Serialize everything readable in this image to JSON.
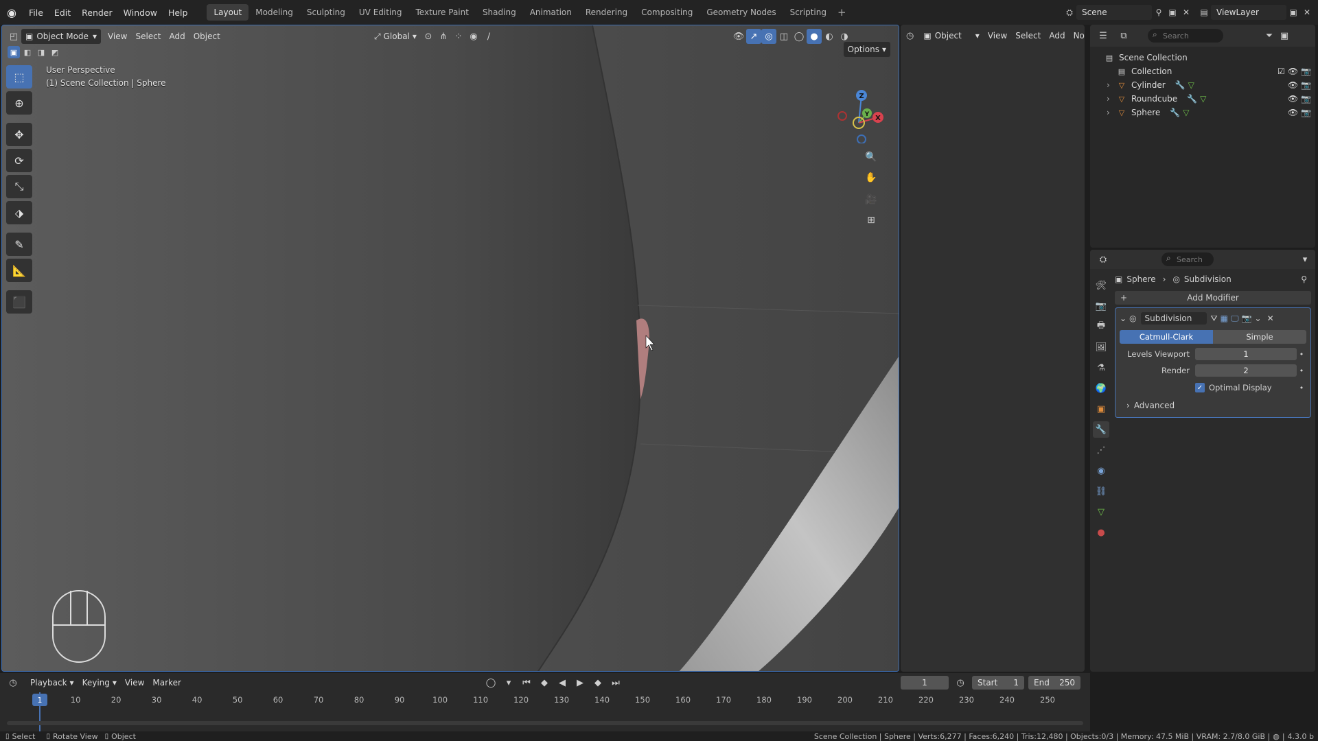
{
  "menubar": {
    "items": [
      "File",
      "Edit",
      "Render",
      "Window",
      "Help"
    ],
    "workspaces": [
      "Layout",
      "Modeling",
      "Sculpting",
      "UV Editing",
      "Texture Paint",
      "Shading",
      "Animation",
      "Rendering",
      "Compositing",
      "Geometry Nodes",
      "Scripting"
    ],
    "active_workspace": "Layout",
    "scene": "Scene",
    "view_layer": "ViewLayer"
  },
  "viewport": {
    "mode": "Object Mode",
    "menus": [
      "View",
      "Select",
      "Add",
      "Object"
    ],
    "orientation": "Global",
    "options": "Options",
    "overlay_line1": "User Perspective",
    "overlay_line2": "(1) Scene Collection | Sphere",
    "gizmo_labels": {
      "z": "Z",
      "y": "Y",
      "x": "X"
    }
  },
  "viewport2": {
    "mode": "Object",
    "menus": [
      "View",
      "Select",
      "Add",
      "No"
    ]
  },
  "outliner": {
    "search_placeholder": "Search",
    "root": "Scene Collection",
    "collection": "Collection",
    "objects": [
      "Cylinder",
      "Roundcube",
      "Sphere"
    ]
  },
  "properties": {
    "search_placeholder": "Search",
    "breadcrumb_object": "Sphere",
    "breadcrumb_modifier": "Subdivision",
    "add_modifier": "Add Modifier",
    "modifier_name": "Subdivision",
    "algo_catmull": "Catmull-Clark",
    "algo_simple": "Simple",
    "levels_viewport_label": "Levels Viewport",
    "levels_viewport_value": "1",
    "render_label": "Render",
    "render_value": "2",
    "optimal_display": "Optimal Display",
    "advanced": "Advanced"
  },
  "timeline": {
    "menus": [
      "Playback",
      "Keying",
      "View",
      "Marker"
    ],
    "current_frame": "1",
    "start_label": "Start",
    "start_value": "1",
    "end_label": "End",
    "end_value": "250",
    "ticks": [
      "1",
      "10",
      "20",
      "30",
      "40",
      "50",
      "60",
      "70",
      "80",
      "90",
      "100",
      "110",
      "120",
      "130",
      "140",
      "150",
      "160",
      "170",
      "180",
      "190",
      "200",
      "210",
      "220",
      "230",
      "240",
      "250"
    ]
  },
  "statusbar": {
    "select": "Select",
    "rotate_view": "Rotate View",
    "object": "Object",
    "stats": "Scene Collection | Sphere | Verts:6,277 | Faces:6,240 | Tris:12,480 | Objects:0/3 | Memory: 47.5 MiB | VRAM: 2.7/8.0 GiB |",
    "version": "4.3.0 b"
  },
  "colors": {
    "accent": "#4772b3",
    "object_orange": "#e08d3c",
    "mesh_green": "#6fbf4a"
  }
}
